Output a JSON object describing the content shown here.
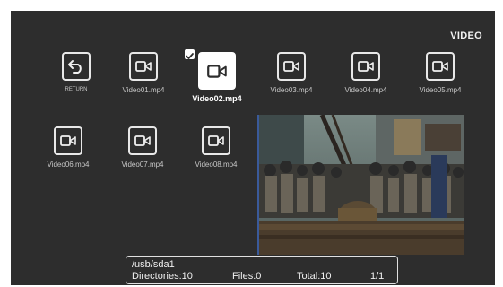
{
  "header": {
    "title": "VIDEO"
  },
  "return": {
    "label": "RETURN",
    "icon": "return-arrow-icon"
  },
  "files": [
    {
      "name": "Video01.mp4",
      "selected": false
    },
    {
      "name": "Video02.mp4",
      "selected": true
    },
    {
      "name": "Video03.mp4",
      "selected": false
    },
    {
      "name": "Video04.mp4",
      "selected": false
    },
    {
      "name": "Video05.mp4",
      "selected": false
    },
    {
      "name": "Video06.mp4",
      "selected": false
    },
    {
      "name": "Video07.mp4",
      "selected": false
    },
    {
      "name": "Video08.mp4",
      "selected": false
    }
  ],
  "status": {
    "path": "/usb/sda1",
    "directories": "Directories:10",
    "files": "Files:0",
    "total": "Total:10",
    "page": "1/1"
  },
  "colors": {
    "background": "#2d2d2d",
    "selected_tile": "#ffffff",
    "icon_stroke": "#e8e8e8"
  }
}
